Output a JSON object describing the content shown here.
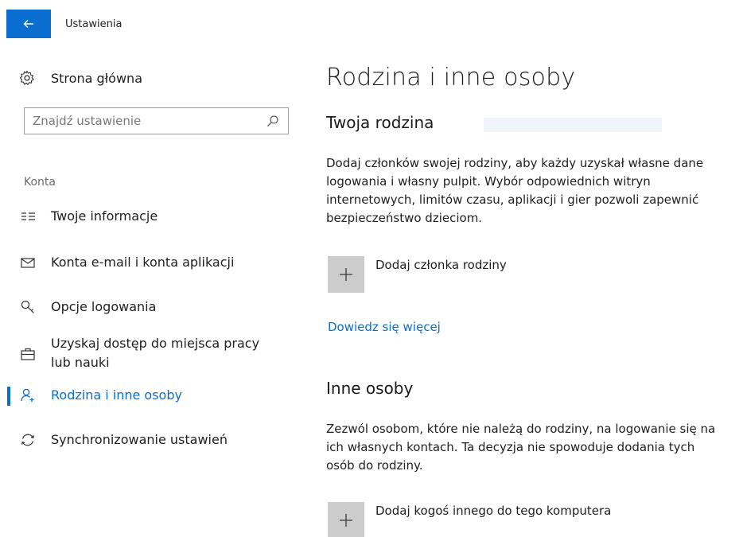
{
  "window": {
    "title": "Ustawienia",
    "back_label": "Wstecz"
  },
  "sidebar": {
    "home_label": "Strona główna",
    "search_placeholder": "Znajdź ustawienie",
    "section_label": "Konta",
    "items": [
      {
        "label": "Twoje informacje",
        "icon": "person-info-icon",
        "active": false
      },
      {
        "label": "Konta e-mail i konta aplikacji",
        "icon": "mail-icon",
        "active": false
      },
      {
        "label": "Opcje logowania",
        "icon": "key-icon",
        "active": false
      },
      {
        "label": "Uzyskaj dostęp do miejsca pracy lub nauki",
        "icon": "briefcase-icon",
        "active": false
      },
      {
        "label": "Rodzina i inne osoby",
        "icon": "add-person-icon",
        "active": true
      },
      {
        "label": "Synchronizowanie ustawień",
        "icon": "sync-icon",
        "active": false
      }
    ]
  },
  "main": {
    "page_title": "Rodzina i inne osoby",
    "family": {
      "heading": "Twoja rodzina",
      "description": "Dodaj członków swojej rodziny, aby każdy uzyskał własne dane logowania i własny pulpit. Wybór odpowiednich witryn internetowych, limitów czasu, aplikacji i gier pozwoli zapewnić bezpieczeństwo dzieciom.",
      "add_label": "Dodaj członka rodziny",
      "learn_more": "Dowiedz się więcej"
    },
    "others": {
      "heading": "Inne osoby",
      "description": "Zezwól osobom, które nie należą do rodziny, na logowanie się na ich własnych kontach. Ta decyzja nie spowoduje dodania tych osób do rodziny.",
      "add_label": "Dodaj kogoś innego do tego komputera"
    }
  },
  "colors": {
    "accent": "#0a6ed1",
    "tile": "#cccccc",
    "muted_text": "#6a6a6a"
  }
}
